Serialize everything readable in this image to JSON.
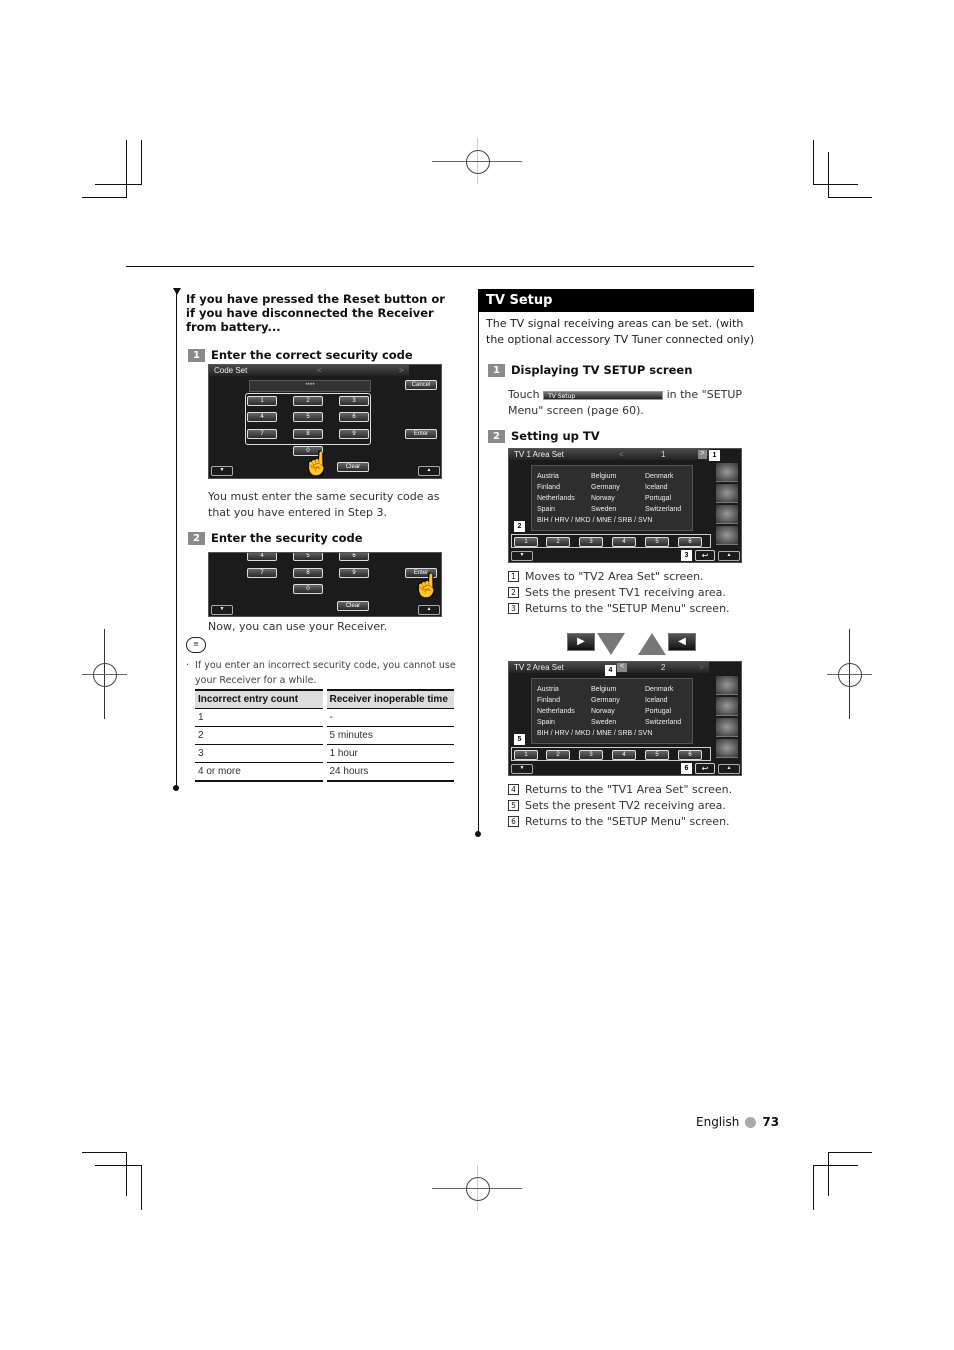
{
  "left": {
    "intro_heading": "If you have pressed the Reset button or if you have disconnected the Receiver from battery...",
    "step1": {
      "num": "1",
      "label": "Enter the correct security code"
    },
    "code_screen": {
      "title": "Code Set",
      "masked_code": "****",
      "keys": [
        "1",
        "2",
        "3",
        "4",
        "5",
        "6",
        "7",
        "8",
        "9",
        "0"
      ],
      "cancel": "Cancel",
      "enter": "Enter",
      "clear": "Clear"
    },
    "step1_note": "You must enter the same security code as that you have entered in Step 3.",
    "step2": {
      "num": "2",
      "label": "Enter the security code"
    },
    "code_screen2": {
      "keys": [
        "4",
        "5",
        "6",
        "7",
        "8",
        "9",
        "0"
      ],
      "enter": "Enter",
      "clear": "Clear"
    },
    "step2_note": "Now, you can use your Receiver.",
    "memo_bullet": "If you enter an incorrect security code, you cannot use your Receiver for a while.",
    "table": {
      "headers": [
        "Incorrect entry count",
        "Receiver inoperable time"
      ],
      "rows": [
        [
          "1",
          "-"
        ],
        [
          "2",
          "5 minutes"
        ],
        [
          "3",
          "1 hour"
        ],
        [
          "4 or more",
          "24 hours"
        ]
      ]
    }
  },
  "right": {
    "section_title": "TV Setup",
    "intro": "The TV signal receiving areas can be set. (with the optional accessory TV Tuner connected only)",
    "step1": {
      "num": "1",
      "label": "Displaying TV SETUP screen"
    },
    "step1_text_before": "Touch",
    "step1_button": "TV Setup",
    "step1_text_after": "in the \"SETUP Menu\" screen (page 60).",
    "step2": {
      "num": "2",
      "label": "Setting up TV"
    },
    "tv1_screen": {
      "title": "TV 1 Area Set",
      "page": "1",
      "countries": [
        "Austria",
        "Belgium",
        "Denmark",
        "Finland",
        "Germany",
        "Iceland",
        "Netherlands",
        "Norway",
        "Portugal",
        "Spain",
        "Sweden",
        "Switzerland"
      ],
      "group": "BIH / HRV / MKD / MNE / SRB / SVN",
      "presets": [
        "1",
        "2",
        "3",
        "4",
        "5",
        "6"
      ],
      "callouts": [
        "1",
        "2",
        "3"
      ]
    },
    "tv1_notes": [
      {
        "num": "1",
        "text": "Moves to \"TV2 Area Set\" screen."
      },
      {
        "num": "2",
        "text": "Sets the present TV1 receiving area."
      },
      {
        "num": "3",
        "text": "Returns to the \"SETUP Menu\" screen."
      }
    ],
    "tv2_screen": {
      "title": "TV 2 Area Set",
      "page": "2",
      "countries": [
        "Austria",
        "Belgium",
        "Denmark",
        "Finland",
        "Germany",
        "Iceland",
        "Netherlands",
        "Norway",
        "Portugal",
        "Spain",
        "Sweden",
        "Switzerland"
      ],
      "group": "BIH / HRV / MKD / MNE / SRB / SVN",
      "presets": [
        "1",
        "2",
        "3",
        "4",
        "5",
        "6"
      ],
      "callouts": [
        "4",
        "5",
        "6"
      ]
    },
    "tv2_notes": [
      {
        "num": "4",
        "text": "Returns to the \"TV1 Area Set\" screen."
      },
      {
        "num": "5",
        "text": "Sets the present TV2 receiving area."
      },
      {
        "num": "6",
        "text": "Returns to the \"SETUP Menu\" screen."
      }
    ],
    "icons": {
      "next": "▶",
      "prev": "◀",
      "return": "↩",
      "left_arrow": "<",
      "right_arrow": ">"
    }
  },
  "footer": {
    "language": "English",
    "page": "73"
  }
}
